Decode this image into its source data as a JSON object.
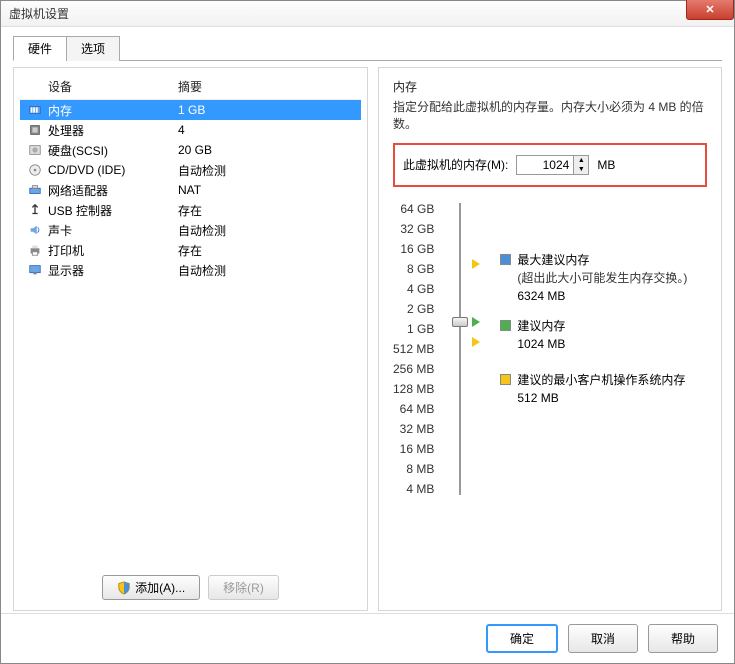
{
  "window_title": "虚拟机设置",
  "tabs": {
    "hardware": "硬件",
    "options": "选项"
  },
  "columns": {
    "device": "设备",
    "summary": "摘要"
  },
  "devices": [
    {
      "name": "内存",
      "summary": "1 GB",
      "icon": "memory",
      "selected": true
    },
    {
      "name": "处理器",
      "summary": "4",
      "icon": "cpu"
    },
    {
      "name": "硬盘(SCSI)",
      "summary": "20 GB",
      "icon": "disk"
    },
    {
      "name": "CD/DVD (IDE)",
      "summary": "自动检测",
      "icon": "cd"
    },
    {
      "name": "网络适配器",
      "summary": "NAT",
      "icon": "net"
    },
    {
      "name": "USB 控制器",
      "summary": "存在",
      "icon": "usb"
    },
    {
      "name": "声卡",
      "summary": "自动检测",
      "icon": "sound"
    },
    {
      "name": "打印机",
      "summary": "存在",
      "icon": "printer"
    },
    {
      "name": "显示器",
      "summary": "自动检测",
      "icon": "display"
    }
  ],
  "buttons": {
    "add": "添加(A)...",
    "remove": "移除(R)",
    "ok": "确定",
    "cancel": "取消",
    "help": "帮助"
  },
  "memory": {
    "title": "内存",
    "desc": "指定分配给此虚拟机的内存量。内存大小必须为 4 MB 的倍数。",
    "label": "此虚拟机的内存(M):",
    "value": "1024",
    "unit": "MB",
    "ticks": [
      "64 GB",
      "32 GB",
      "16 GB",
      "8 GB",
      "4 GB",
      "2 GB",
      "1 GB",
      "512 MB",
      "256 MB",
      "128 MB",
      "64 MB",
      "32 MB",
      "16 MB",
      "8 MB",
      "4 MB"
    ],
    "legend": {
      "max": {
        "title": "最大建议内存",
        "note": "(超出此大小可能发生内存交换。)",
        "value": "6324 MB"
      },
      "rec": {
        "title": "建议内存",
        "value": "1024 MB"
      },
      "min": {
        "title": "建议的最小客户机操作系统内存",
        "value": "512 MB"
      }
    }
  }
}
